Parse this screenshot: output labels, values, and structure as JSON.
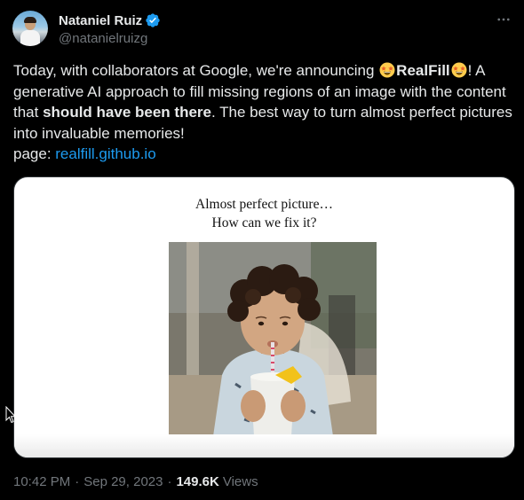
{
  "author": {
    "display_name": "Nataniel Ruiz",
    "handle": "@natanielruizg",
    "verified": true
  },
  "post": {
    "line1_prefix": "Today, with collaborators at Google, we're announcing ",
    "product_name": "RealFill",
    "line1_suffix": "! A generative AI approach to fill missing regions of an image with the content that ",
    "bold_phrase": "should have been there",
    "line1_end": ". The best way to turn almost perfect pictures into invaluable memories!",
    "page_label": "page: ",
    "page_link": "realfill.github.io",
    "emoji": "star-struck-emoji"
  },
  "media": {
    "caption_line1": "Almost perfect picture…",
    "caption_line2": "How can we fix it?",
    "image_alt": "Photo of a curly-haired child drinking from a cup with a straw"
  },
  "meta": {
    "time": "10:42 PM",
    "date": "Sep 29, 2023",
    "separator": "·",
    "views_count": "149.6K",
    "views_label": "Views"
  },
  "colors": {
    "background": "#000000",
    "text": "#e7e9ea",
    "secondary": "#71767b",
    "link": "#1d9bf0",
    "verified": "#1d9bf0"
  },
  "icons": [
    "verified-badge-icon",
    "more-options-icon",
    "star-struck-emoji",
    "mouse-cursor-icon"
  ]
}
